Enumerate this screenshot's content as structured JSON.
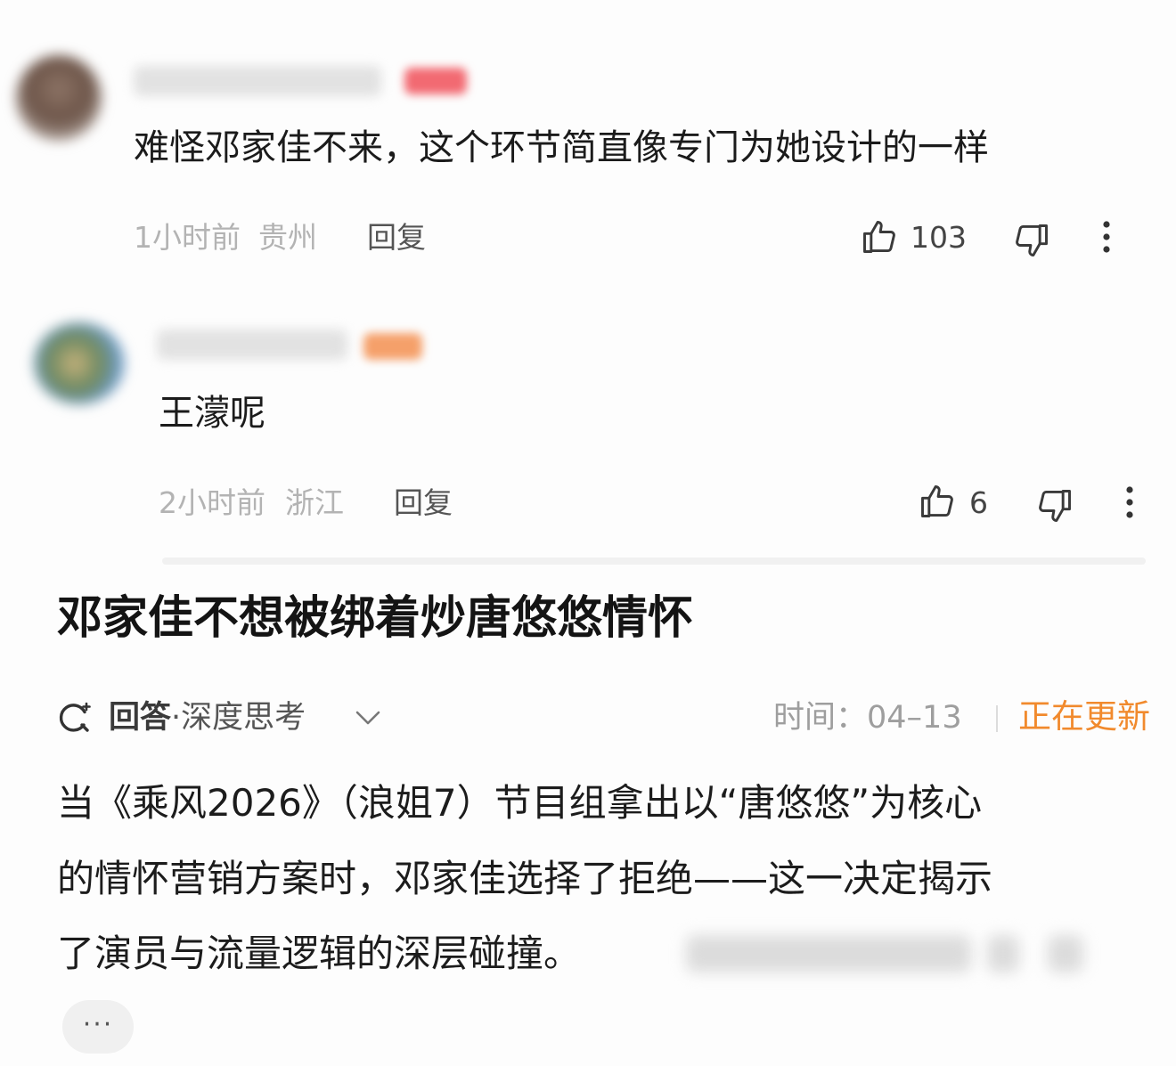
{
  "comments": [
    {
      "text": "难怪邓家佳不来，这个环节简直像专门为她设计的一样",
      "time": "1小时前",
      "location": "贵州",
      "reply_label": "回复",
      "likes": "103"
    },
    {
      "text": "王濛呢",
      "time": "2小时前",
      "location": "浙江",
      "reply_label": "回复",
      "likes": "6"
    }
  ],
  "answer": {
    "title": "邓家佳不想被绑着炒唐悠悠情怀",
    "label": "回答",
    "mode": "·深度思考",
    "time_label": "时间：",
    "time_value": "04–13",
    "status": "正在更新",
    "lines": [
      "当《乘风2026》（浪姐7）节目组拿出以“唐悠悠”为核心",
      "的情怀营销方案时，邓家佳选择了拒绝——这一决定揭示",
      "了演员与流量逻辑的深层碰撞。"
    ],
    "more_label": "···"
  },
  "colors": {
    "accent_orange": "#f18a2d",
    "meta_gray": "#b3b3b3",
    "badge_red": "#f0606a",
    "badge_orange": "#f39a5a"
  },
  "icons": [
    "thumbs-up-icon",
    "thumbs-down-icon",
    "more-vertical-icon",
    "search-sparkle-icon",
    "chevron-down-icon"
  ]
}
